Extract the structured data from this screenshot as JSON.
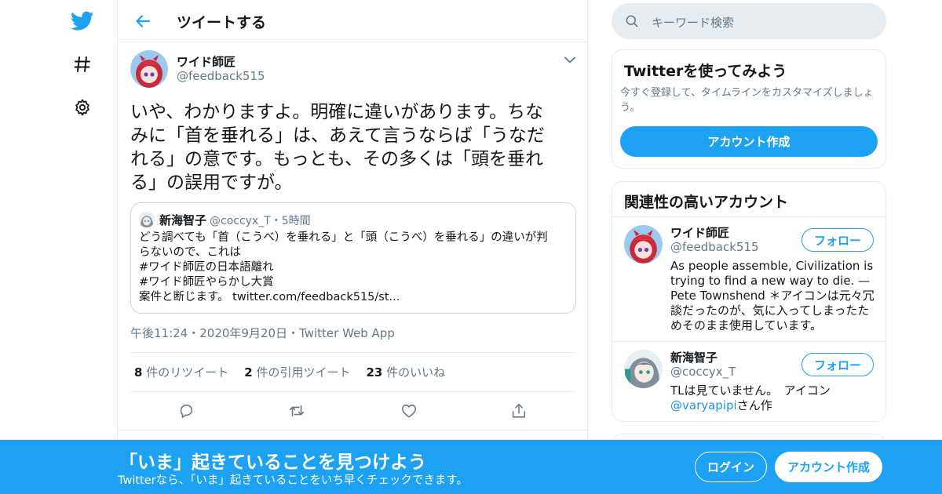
{
  "colors": {
    "accent": "#1da1f2",
    "secondary_text": "#657786",
    "border": "#e6ecf0"
  },
  "nav": {
    "icons": [
      "twitter-logo-icon",
      "hashtag-icon",
      "gear-icon"
    ]
  },
  "header": {
    "title": "ツイートする"
  },
  "tweet": {
    "author_name": "ワイド師匠",
    "author_handle": "@feedback515",
    "text": "いや、わかりますよ。明確に違いがあります。ちな\nみに「首を垂れる」は、あえて言うならば「うなだ\nれる」の意です。もっとも、その多くは「頭を垂れ\nる」の誤用ですが。",
    "quote": {
      "name": "新海智子",
      "handle_time": "@coccyx_T・5時間",
      "text": "どう調べても「首（こうべ）を垂れる」と「頭（こうべ）を垂れる」の違いが判\nらないので、これは\n#ワイド師匠の日本語離れ\n#ワイド師匠やらかし大賞\n案件と断じます。 twitter.com/feedback515/st..."
    },
    "meta": "午後11:24・2020年9月20日・Twitter Web App",
    "stats": {
      "retweets_count": "8",
      "retweets_label": "件のリツイート",
      "quotes_count": "2",
      "quotes_label": "件の引用ツイート",
      "likes_count": "23",
      "likes_label": "件のいいね"
    },
    "actions": [
      "reply-icon",
      "retweet-icon",
      "like-icon",
      "share-icon"
    ]
  },
  "search": {
    "placeholder": "キーワード検索"
  },
  "signup_card": {
    "title": "Twitterを使ってみよう",
    "subtitle": "今すぐ登録して、タイムラインをカスタマイズしましょう。",
    "button": "アカウント作成"
  },
  "related": {
    "title": "関連性の高いアカウント",
    "accounts": [
      {
        "name": "ワイド師匠",
        "handle": "@feedback515",
        "follow": "フォロー",
        "bio": "As people assemble, Civilization is trying to find a new way to die. — Pete Townshend ＊アイコンは元々冗談だったのが、気に入ってしまったためそのまま使用しています。"
      },
      {
        "name": "新海智子",
        "handle": "@coccyx_T",
        "follow": "フォロー",
        "bio_prefix": "TLは見ていません。　アイコン",
        "bio_link": "@varyapipi",
        "bio_suffix": "さん作"
      }
    ]
  },
  "banner": {
    "title": "「いま」起きていることを見つけよう",
    "subtitle": "Twitterなら、「いま」起きていることをいち早くチェックできます。",
    "login": "ログイン",
    "signup": "アカウント作成"
  }
}
